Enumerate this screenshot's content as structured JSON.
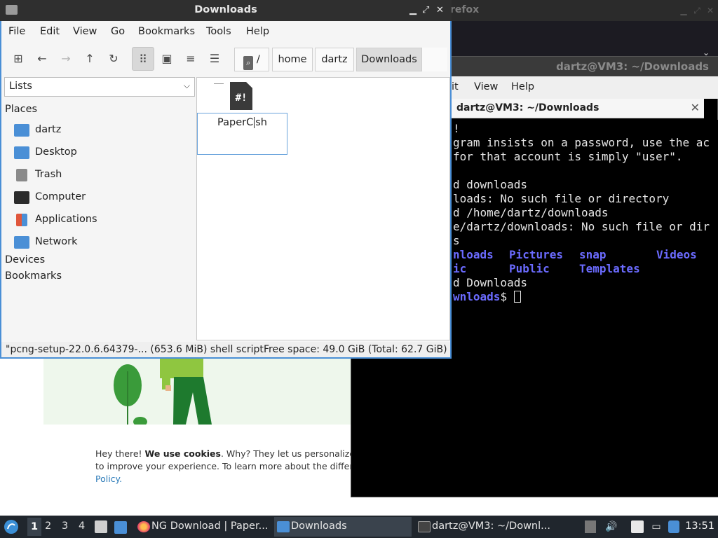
{
  "firefox": {
    "title": "refox",
    "cookie": {
      "line1_pre": "Hey there!",
      "line1_bold": "We use cookies",
      "line1_post": ". Why? They let us personalize cont",
      "line2": "to improve your experience. To learn more about the different",
      "line3": "Policy."
    }
  },
  "terminal": {
    "window_title": "dartz@VM3: ~/Downloads",
    "menu": [
      "it",
      "View",
      "Help"
    ],
    "tab_title": "dartz@VM3: ~/Downloads",
    "lines": [
      "!",
      "gram insists on a password, use the ac",
      "for that account is simply \"user\".",
      "",
      "d downloads",
      "loads: No such file or directory",
      "d /home/dartz/downloads",
      "e/dartz/downloads: No such file or dir",
      "s"
    ],
    "ls_row1": [
      "nloads",
      "Pictures",
      "snap",
      "Videos"
    ],
    "ls_row2": [
      "ic",
      "Public",
      "Templates"
    ],
    "line_cd": "d Downloads",
    "prompt": "wnloads"
  },
  "file_manager": {
    "title": "Downloads",
    "menu": [
      "File",
      "Edit",
      "View",
      "Go",
      "Bookmarks",
      "Tools",
      "Help"
    ],
    "breadcrumb": [
      "/",
      "home",
      "dartz",
      "Downloads"
    ],
    "side_view": "Lists",
    "places_header": "Places",
    "places": [
      {
        "label": "dartz",
        "icon": "home-folder-icon",
        "color": "#4a8fd6"
      },
      {
        "label": "Desktop",
        "icon": "desktop-folder-icon",
        "color": "#4a8fd6"
      },
      {
        "label": "Trash",
        "icon": "trash-icon",
        "color": "#8a8a8a"
      },
      {
        "label": "Computer",
        "icon": "computer-icon",
        "color": "#2b2b2b"
      },
      {
        "label": "Applications",
        "icon": "applications-icon",
        "color": "#e0563b"
      },
      {
        "label": "Network",
        "icon": "network-icon",
        "color": "#4a8fd6"
      }
    ],
    "devices_header": "Devices",
    "bookmarks_header": "Bookmarks",
    "file_name_before_cursor": "PaperC",
    "file_name_after_cursor": "sh",
    "file_icon_glyph": "#!",
    "status_file": "\"pcng-setup-22.0.6.64379-... (653.6 MiB) shell script",
    "status_space": "Free space: 49.0 GiB (Total: 62.7 GiB)"
  },
  "taskbar": {
    "workspaces": [
      "1",
      "2",
      "3",
      "4"
    ],
    "tasks": [
      {
        "label": "NG Download | Paper...",
        "icon": "firefox-icon"
      },
      {
        "label": "Downloads",
        "icon": "folder-icon"
      },
      {
        "label": "dartz@VM3: ~/Downl...",
        "icon": "terminal-icon"
      }
    ],
    "clock": "13:51"
  },
  "colors": {
    "accent": "#4a8fd6",
    "terminal_dir": "#6b6bff",
    "taskbar_bg": "#20262d"
  }
}
